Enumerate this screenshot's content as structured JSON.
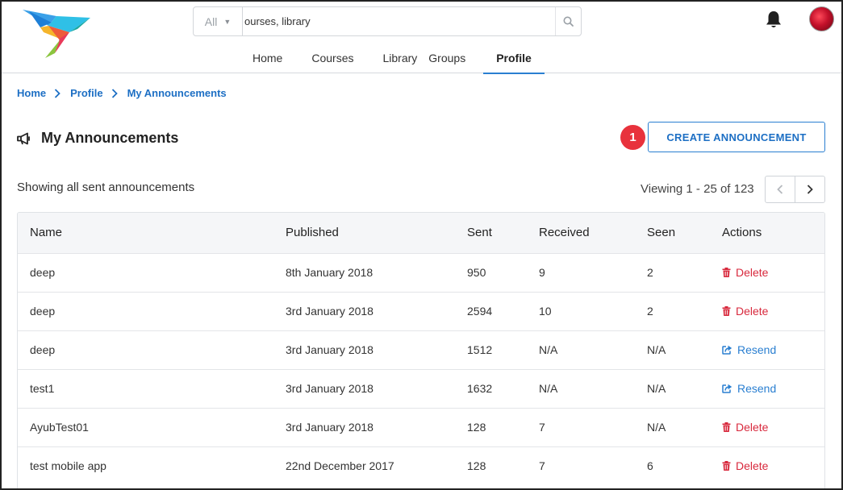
{
  "header": {
    "search": {
      "filter_label": "All",
      "value": "ourses, library"
    },
    "nav": [
      {
        "label": "Home",
        "active": false
      },
      {
        "label": "Courses",
        "active": false
      },
      {
        "label": "Library",
        "active": false
      },
      {
        "label": "Groups",
        "active": false
      },
      {
        "label": "Profile",
        "active": true
      }
    ]
  },
  "breadcrumb": [
    "Home",
    "Profile",
    "My Announcements"
  ],
  "page": {
    "title": "My Announcements",
    "create_button": "CREATE ANNOUNCEMENT",
    "badge": "1",
    "subtitle": "Showing all sent announcements",
    "pager_text": "Viewing 1 - 25 of 123"
  },
  "table": {
    "columns": [
      "Name",
      "Published",
      "Sent",
      "Received",
      "Seen",
      "Actions"
    ],
    "rows": [
      {
        "name": "deep",
        "published": "8th January 2018",
        "sent": "950",
        "received": "9",
        "seen": "2",
        "action": "Delete"
      },
      {
        "name": "deep",
        "published": "3rd January 2018",
        "sent": "2594",
        "received": "10",
        "seen": "2",
        "action": "Delete"
      },
      {
        "name": "deep",
        "published": "3rd January 2018",
        "sent": "1512",
        "received": "N/A",
        "seen": "N/A",
        "action": "Resend"
      },
      {
        "name": "test1",
        "published": "3rd January 2018",
        "sent": "1632",
        "received": "N/A",
        "seen": "N/A",
        "action": "Resend"
      },
      {
        "name": "AyubTest01",
        "published": "3rd January 2018",
        "sent": "128",
        "received": "7",
        "seen": "N/A",
        "action": "Delete"
      },
      {
        "name": "test mobile app",
        "published": "22nd December 2017",
        "sent": "128",
        "received": "7",
        "seen": "6",
        "action": "Delete"
      }
    ]
  },
  "colors": {
    "accent": "#2a7fd1",
    "link": "#1d6fc4",
    "danger": "#d8293d",
    "badge": "#e8323c"
  },
  "icons": {
    "logo": "hummingbird-logo",
    "search": "search-icon",
    "bell": "bell-icon",
    "megaphone": "megaphone-icon",
    "delete": "trash-icon",
    "resend": "share-icon"
  }
}
